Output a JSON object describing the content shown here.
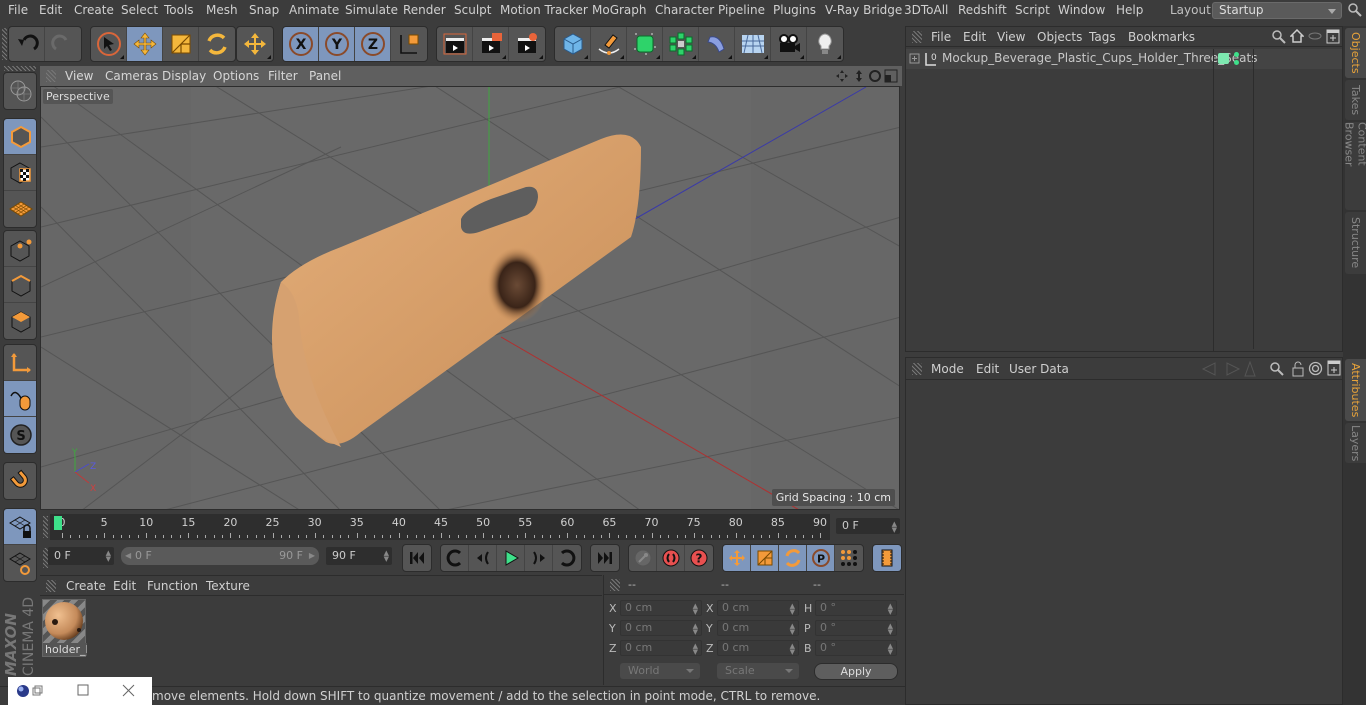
{
  "menubar": {
    "items": [
      "File",
      "Edit",
      "Create",
      "Select",
      "Tools",
      "Mesh",
      "Snap",
      "Animate",
      "Simulate",
      "Render",
      "Sculpt",
      "Motion Tracker",
      "MoGraph",
      "Character",
      "Pipeline",
      "Plugins",
      "V-Ray Bridge",
      "3DToAll",
      "Redshift",
      "Script",
      "Window",
      "Help"
    ],
    "layout_label": "Layout:",
    "layout_value": "Startup"
  },
  "toolbar": {
    "groups": [
      [
        "undo-icon",
        "redo-icon"
      ],
      [
        "live-selection-icon",
        "move-icon",
        "scale-icon",
        "rotate-icon"
      ],
      [
        "recent-tool-icon"
      ],
      [
        "x-axis-lock-icon",
        "y-axis-lock-icon",
        "z-axis-lock-icon",
        "coordinate-system-icon"
      ],
      [
        "render-view-icon",
        "render-picture-viewer-icon",
        "render-settings-icon"
      ],
      [
        "cube-object-icon",
        "pen-spline-icon",
        "subdivision-surface-icon",
        "cloner-icon",
        "deformer-bend-icon",
        "floor-environment-icon",
        "camera-icon",
        "light-icon"
      ]
    ],
    "active": [
      "move-icon",
      "x-axis-lock-icon",
      "y-axis-lock-icon",
      "z-axis-lock-icon"
    ]
  },
  "left_tools": [
    "make-editable-icon",
    "model-mode-icon",
    "texture-mode-icon",
    "workplane-mode-icon",
    "points-mode-icon",
    "edges-mode-icon",
    "polygons-mode-icon",
    "axis-mode-icon",
    "tweak-mode-icon",
    "solo-mode-icon",
    "snap-magnet-icon",
    "workplane-lock-icon",
    "workplane-align-icon"
  ],
  "viewport": {
    "menu": [
      "View",
      "Cameras",
      "Display",
      "Options",
      "Filter",
      "Panel"
    ],
    "camera_label": "Perspective",
    "grid_spacing": "Grid Spacing : 10 cm",
    "axis_labels": {
      "y": "Y",
      "z": "Z",
      "x": "X"
    }
  },
  "timeline": {
    "ticks": [
      "0",
      "5",
      "10",
      "15",
      "20",
      "25",
      "30",
      "35",
      "40",
      "45",
      "50",
      "55",
      "60",
      "65",
      "70",
      "75",
      "80",
      "85",
      "90"
    ],
    "current_frame_field": "0 F",
    "start_field": "0 F",
    "range_start": "0 F",
    "range_end": "90 F",
    "end_field": "90 F",
    "current_frame_position": 0
  },
  "materials": {
    "menu": [
      "Create",
      "Edit",
      "Function",
      "Texture"
    ],
    "items": [
      {
        "name": "holder_l"
      }
    ]
  },
  "coordinates": {
    "headers": [
      "--",
      "--",
      "--"
    ],
    "position": [
      {
        "axis": "X",
        "value": "0 cm"
      },
      {
        "axis": "Y",
        "value": "0 cm"
      },
      {
        "axis": "Z",
        "value": "0 cm"
      }
    ],
    "size": [
      {
        "axis": "X",
        "value": "0 cm"
      },
      {
        "axis": "Y",
        "value": "0 cm"
      },
      {
        "axis": "Z",
        "value": "0 cm"
      }
    ],
    "rotation": [
      {
        "axis": "H",
        "value": "0 °"
      },
      {
        "axis": "P",
        "value": "0 °"
      },
      {
        "axis": "B",
        "value": "0 °"
      }
    ],
    "space_dropdown": "World",
    "mode_dropdown": "Scale",
    "apply_label": "Apply"
  },
  "objects_panel": {
    "menu": [
      "File",
      "Edit",
      "View",
      "Objects",
      "Tags",
      "Bookmarks"
    ],
    "objects": [
      {
        "name": "Mockup_Beverage_Plastic_Cups_Holder_Three_Seats",
        "layer_color": "#7de8b0"
      }
    ]
  },
  "attributes_panel": {
    "menu": [
      "Mode",
      "Edit",
      "User Data"
    ]
  },
  "right_tabs": {
    "top": [
      {
        "label": "Objects",
        "active": true
      },
      {
        "label": "Takes",
        "active": false
      },
      {
        "label": "Content Browser",
        "active": false
      },
      {
        "label": "Structure",
        "active": false
      }
    ],
    "bottom": [
      {
        "label": "Attributes",
        "active": true
      },
      {
        "label": "Layers",
        "active": false
      }
    ]
  },
  "status": {
    "text": "move elements. Hold down SHIFT to quantize movement / add to the selection in point mode, CTRL to remove."
  },
  "logo": {
    "brand": "MAXON",
    "product": "CINEMA 4D"
  },
  "colors": {
    "accent": "#e8a33a",
    "active_button": "#7e97bd",
    "frame_marker": "#3ee08a",
    "object_tan": "#d9a06b"
  }
}
